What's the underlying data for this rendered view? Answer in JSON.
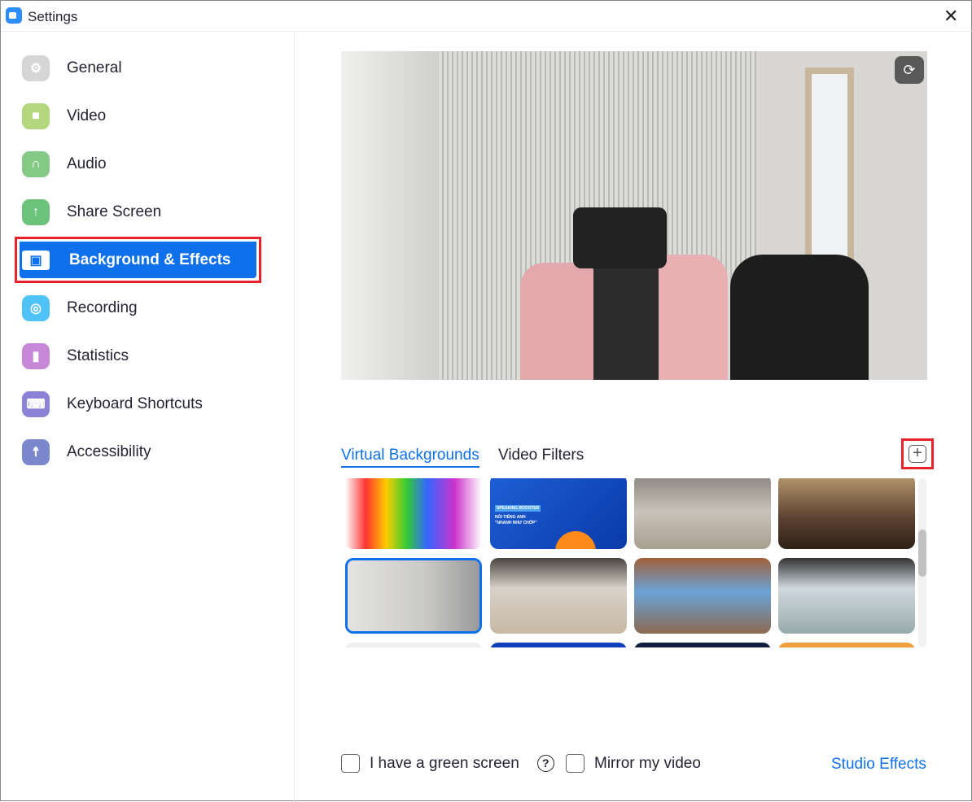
{
  "window": {
    "title": "Settings",
    "close": "✕"
  },
  "sidebar": {
    "items": [
      {
        "label": "General",
        "icon": "gear-icon",
        "color": "#d6d6d6",
        "glyph": "⚙"
      },
      {
        "label": "Video",
        "icon": "video-camera-icon",
        "color": "#b2d77e",
        "glyph": "■"
      },
      {
        "label": "Audio",
        "icon": "headphones-icon",
        "color": "#85c987",
        "glyph": "∩"
      },
      {
        "label": "Share Screen",
        "icon": "share-screen-icon",
        "color": "#6bc27a",
        "glyph": "↑"
      },
      {
        "label": "Background & Effects",
        "icon": "background-person-icon",
        "color": "#0e71eb",
        "glyph": "▣",
        "selected": true
      },
      {
        "label": "Recording",
        "icon": "recording-icon",
        "color": "#4fc3f7",
        "glyph": "◎"
      },
      {
        "label": "Statistics",
        "icon": "statistics-icon",
        "color": "#c688d6",
        "glyph": "▮"
      },
      {
        "label": "Keyboard Shortcuts",
        "icon": "keyboard-icon",
        "color": "#8c83d6",
        "glyph": "⌨"
      },
      {
        "label": "Accessibility",
        "icon": "accessibility-icon",
        "color": "#7b88cc",
        "glyph": "☨"
      }
    ]
  },
  "preview": {
    "rotate_icon": "rotate-camera-icon",
    "rotate_glyph": "⟳"
  },
  "tabs": [
    {
      "label": "Virtual Backgrounds",
      "active": true
    },
    {
      "label": "Video Filters",
      "active": false
    }
  ],
  "add_button": {
    "glyph": "+",
    "icon": "add-icon"
  },
  "thumbnail_text": {
    "line1": "SPEAKING BOOSTER",
    "line2": "NÓI TIẾNG ANH",
    "line3": "\"NHANH NHƯ CHỚP\""
  },
  "footer": {
    "green_screen": "I have a green screen",
    "help": "?",
    "mirror": "Mirror my video",
    "studio_effects": "Studio Effects"
  },
  "colors": {
    "accent": "#0e71eb",
    "highlight": "#e8212b"
  }
}
